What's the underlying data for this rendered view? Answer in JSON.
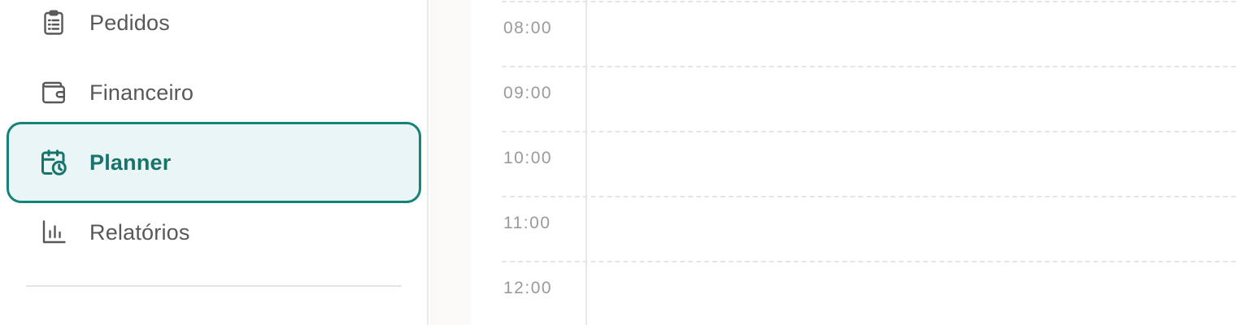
{
  "sidebar": {
    "items": [
      {
        "label": "Pedidos",
        "icon": "clipboard-list-icon",
        "active": false
      },
      {
        "label": "Financeiro",
        "icon": "wallet-icon",
        "active": false
      },
      {
        "label": "Planner",
        "icon": "calendar-clock-icon",
        "active": true
      },
      {
        "label": "Relatórios",
        "icon": "bar-chart-icon",
        "active": false
      }
    ]
  },
  "planner": {
    "hours": [
      "08:00",
      "09:00",
      "10:00",
      "11:00",
      "12:00"
    ]
  },
  "colors": {
    "accent": "#17827a",
    "active_bg": "#eaf6f5",
    "text_muted": "#5a5856"
  }
}
